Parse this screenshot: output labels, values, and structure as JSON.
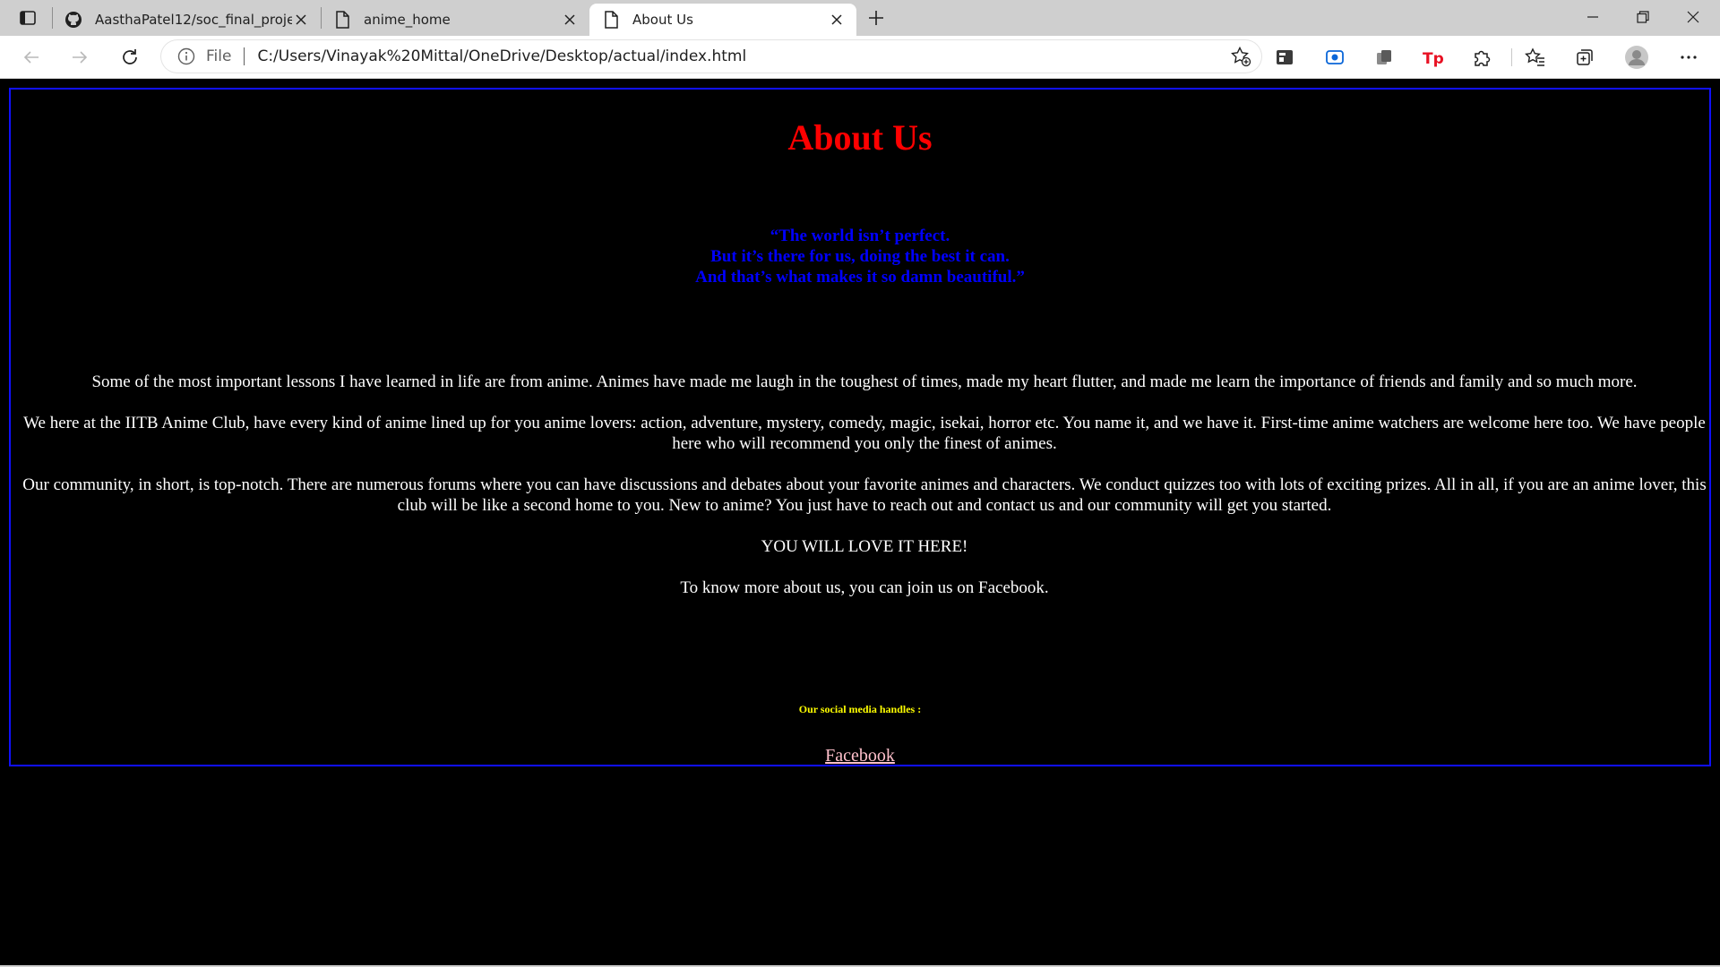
{
  "browser": {
    "tabs": [
      {
        "title": "AasthaPatel12/soc_final_project",
        "icon": "github-icon",
        "active": false
      },
      {
        "title": "anime_home",
        "icon": "page-icon",
        "active": false
      },
      {
        "title": "About Us",
        "icon": "page-icon",
        "active": true
      }
    ],
    "address": {
      "scheme_label": "File",
      "url": "C:/Users/Vinayak%20Mittal/OneDrive/Desktop/actual/index.html"
    },
    "colors": {
      "tabstrip": "#cfcfcf",
      "toolbar": "#ffffff",
      "accent_red": "#e81123",
      "accent_blue": "#0a66d8"
    }
  },
  "page": {
    "heading": "About Us",
    "quote_lines": [
      "“The world isn’t perfect.",
      "But it’s there for us, doing the best it can.",
      "And that’s what makes it so damn beautiful.”"
    ],
    "paragraphs": [
      "Some of the most important lessons I have learned in life are from anime. Animes have made me laugh in the toughest of times, made my heart flutter, and made me learn the importance of friends and family and so much more.",
      "We here at the IITB Anime Club, have every kind of anime lined up for you anime lovers: action, adventure, mystery, comedy, magic, isekai, horror etc. You name it, and we have it. First-time anime watchers are welcome here too. We have people here who will recommend you only the finest of animes.",
      "Our community, in short, is top-notch. There are numerous forums where you can have discussions and debates about your favorite animes and characters. We conduct quizzes too with lots of exciting prizes. All in all, if you are an anime lover, this club will be like a second home to you. New to anime? You just have to reach out and contact us and our community will get you started.",
      "YOU WILL LOVE IT HERE!",
      "To know more about us, you can join us on Facebook."
    ],
    "social_heading": "Our social media handles :",
    "facebook_link": "Facebook",
    "colors": {
      "background": "#000000",
      "heading": "#ff0000",
      "quote": "#0000ff",
      "body_text": "#ffffff",
      "social_heading": "#ffff00",
      "link": "#ffc0cb",
      "border": "#1010ff"
    }
  }
}
